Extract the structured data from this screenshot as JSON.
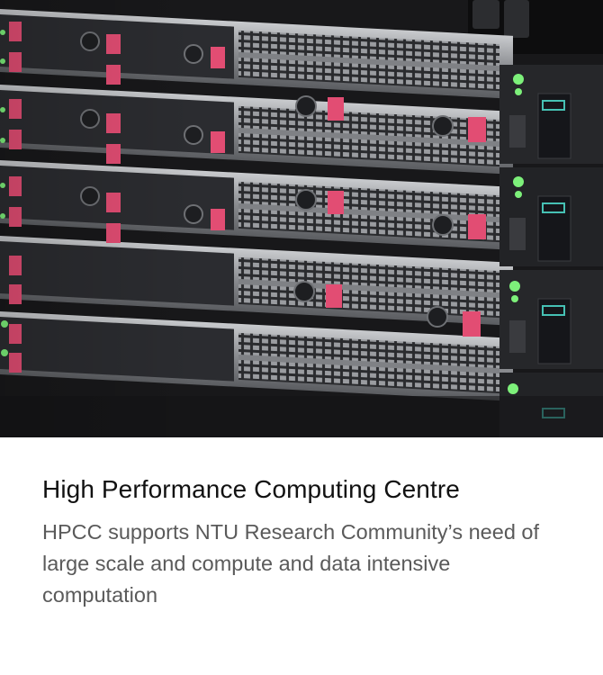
{
  "card": {
    "image": {
      "icon": "server-rack-photo"
    },
    "title": "High Performance Computing Centre",
    "description": "HPCC supports NTU Research Community’s need of large scale and compute and data intensive computation"
  }
}
